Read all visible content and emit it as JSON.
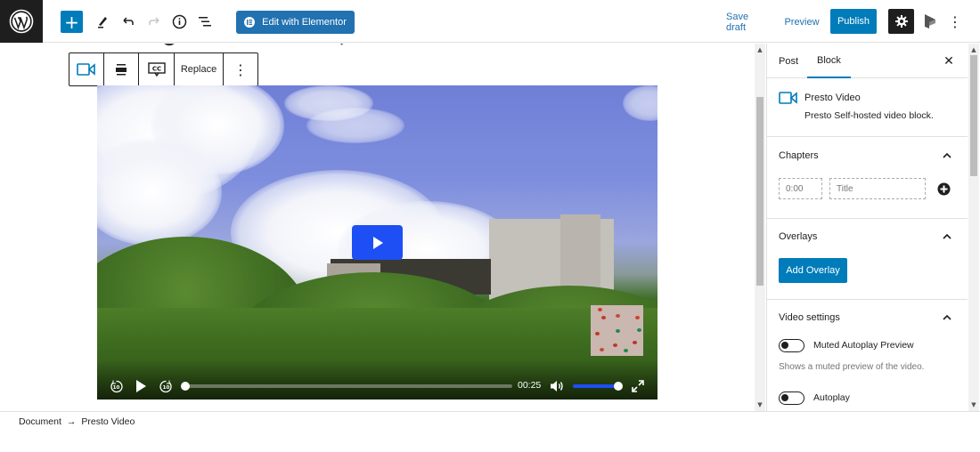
{
  "topbar": {
    "logo": "wordpress-logo",
    "inserter_label": "+",
    "tools": [
      "pencil-icon",
      "undo-icon",
      "redo-icon",
      "info-icon",
      "list-view-icon"
    ],
    "elementor_label": "Edit with Elementor",
    "save_draft_label": "Save draft",
    "preview_label": "Preview",
    "publish_label": "Publish",
    "more_label": "⋮"
  },
  "block_toolbar": {
    "items": [
      "video-icon",
      "align-icon",
      "captions-icon"
    ],
    "replace_label": "Replace",
    "more_label": "⋮"
  },
  "video": {
    "time": "00:25",
    "progress": 0.0,
    "volume": 1.0,
    "colors": {
      "accent": "#1d4ff5"
    }
  },
  "sidebar": {
    "tabs": [
      {
        "label": "Post",
        "active": false
      },
      {
        "label": "Block",
        "active": true
      }
    ],
    "close_label": "✕",
    "block": {
      "title": "Presto Video",
      "description": "Presto Self-hosted video block."
    },
    "chapters": {
      "title": "Chapters",
      "time_placeholder": "0:00",
      "title_placeholder": "Title"
    },
    "overlays": {
      "title": "Overlays",
      "add_label": "Add Overlay"
    },
    "video_settings": {
      "title": "Video settings",
      "toggles": [
        {
          "label": "Muted Autoplay Preview",
          "help": "Shows a muted preview of the video.",
          "on": false
        },
        {
          "label": "Autoplay",
          "on": false
        }
      ]
    }
  },
  "breadcrumb": {
    "items": [
      "Document",
      "Presto Video"
    ],
    "separator": "→"
  },
  "colors": {
    "primary": "#007cba",
    "elementor": "#2271b1",
    "dark": "#1e1e1e"
  }
}
